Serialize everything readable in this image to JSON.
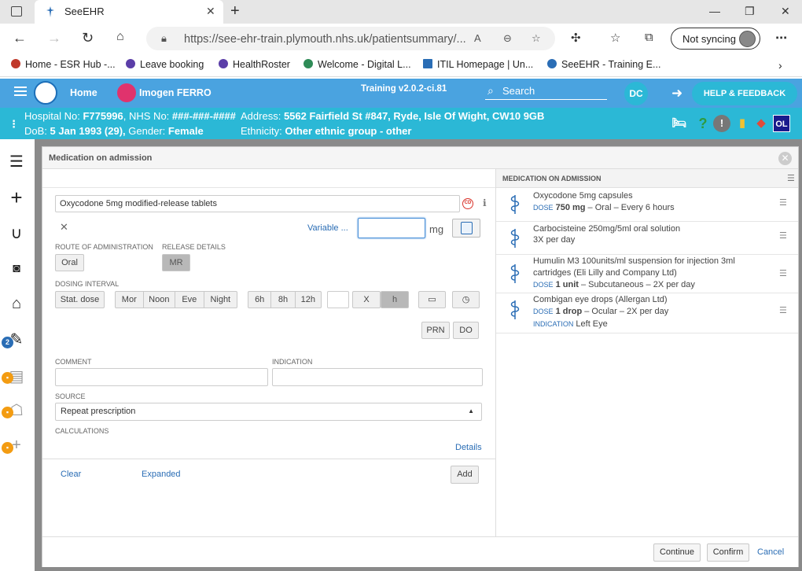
{
  "browser": {
    "tab_title": "SeeEHR",
    "url": "https://see-ehr-train.plymouth.nhs.uk/patientsummary/...",
    "sync_label": "Not syncing",
    "bookmarks": [
      {
        "label": "Home - ESR Hub -...",
        "color": "#c0392b"
      },
      {
        "label": "Leave booking",
        "color": "#5b3ea8"
      },
      {
        "label": "HealthRoster",
        "color": "#5b3ea8"
      },
      {
        "label": "Welcome - Digital L...",
        "color": "#2e8b57"
      },
      {
        "label": "ITIL Homepage | Un...",
        "color": "#2a6db5"
      },
      {
        "label": "SeeEHR - Training E...",
        "color": "#2a6db5"
      }
    ]
  },
  "app": {
    "home_label": "Home",
    "patient_name": "Imogen FERRO",
    "training_label": "Training v2.0.2-ci.81",
    "search_label": "Search",
    "user_initials": "DC",
    "help_label": "HELP & FEEDBACK",
    "accent": "#4aa3e0",
    "banner_color": "#2bb8d6"
  },
  "banner": {
    "hospital_label": "Hospital No:",
    "hospital_no": "F775996",
    "nhs_label": "NHS No:",
    "nhs_no": "###-###-####",
    "address_label": "Address:",
    "address": "5562 Fairfield St #847, Ryde, Isle Of Wight, CW10 9GB",
    "dob_label": "DoB:",
    "dob": "5 Jan 1993 (29),",
    "gender_label": "Gender:",
    "gender": "Female",
    "ethnicity_label": "Ethnicity:",
    "ethnicity": "Other ethnic group - other",
    "badge_ol": "OL"
  },
  "rail": {
    "badge_count": "2"
  },
  "modal": {
    "title": "Medication on admission",
    "drug_value": "Oxycodone 5mg modified-release tablets",
    "variable_label": "Variable ...",
    "dose_value": "",
    "dose_unit": "mg",
    "route_label": "ROUTE OF ADMINISTRATION",
    "route_value": "Oral",
    "release_label": "RELEASE DETAILS",
    "release_value": "MR",
    "dosing_label": "DOSING INTERVAL",
    "stat_dose": "Stat. dose",
    "times": [
      "Mor",
      "Noon",
      "Eve",
      "Night"
    ],
    "hours": [
      "6h",
      "8h",
      "12h"
    ],
    "x_label": "X",
    "h_label": "h",
    "prn_label": "PRN",
    "do_label": "DO",
    "comment_label": "COMMENT",
    "indication_label": "INDICATION",
    "source_label": "SOURCE",
    "source_value": "Repeat prescription",
    "calculations_label": "CALCULATIONS",
    "details_link": "Details",
    "clear_link": "Clear",
    "expanded_link": "Expanded",
    "add_button": "Add",
    "continue_button": "Continue",
    "confirm_button": "Confirm",
    "cancel_link": "Cancel"
  },
  "admission": {
    "title": "MEDICATION ON ADMISSION",
    "items": [
      {
        "name1": "Oxycodone 5mg capsules",
        "name2": "",
        "dose_key": "DOSE",
        "dose": "750 mg",
        "rest": " – Oral – Every 6 hours",
        "indication_key": "",
        "indication": ""
      },
      {
        "name1": "Carbocisteine 250mg/5ml oral solution",
        "name2": "",
        "plain": "3X per day"
      },
      {
        "name1": "Humulin M3 100units/ml suspension for injection 3ml",
        "name2": "cartridges (Eli Lilly and Company Ltd)",
        "dose_key": "DOSE",
        "dose": "1 unit",
        "rest": " – Subcutaneous – 2X per day"
      },
      {
        "name1": "Combigan eye drops (Allergan Ltd)",
        "name2": "",
        "dose_key": "DOSE",
        "dose": "1 drop",
        "rest": " – Ocular – 2X per day",
        "indication_key": "INDICATION",
        "indication": "Left Eye"
      }
    ]
  }
}
